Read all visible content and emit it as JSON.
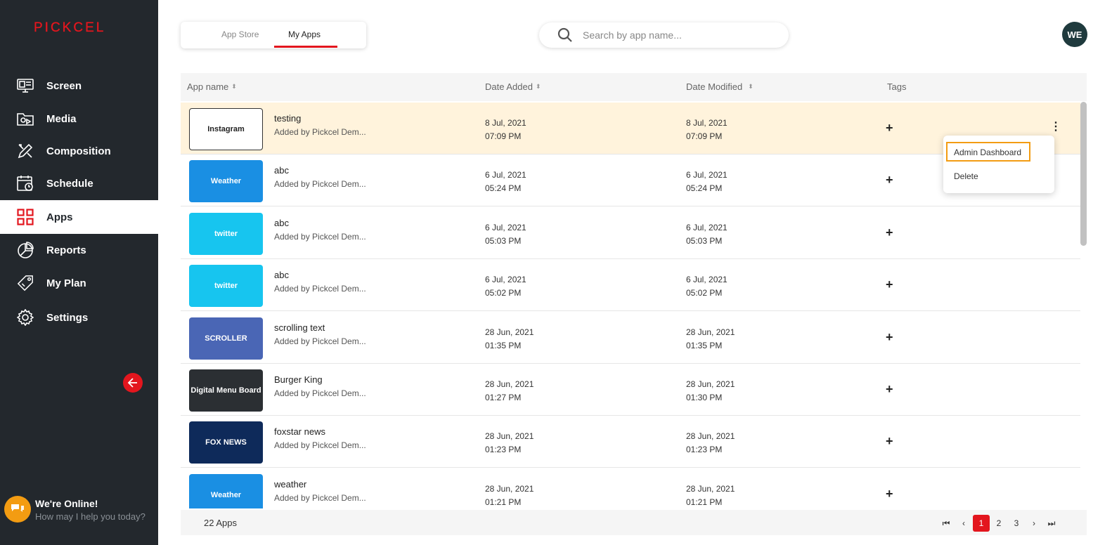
{
  "brand": {
    "logo_text": "PICKCEL",
    "accent": "#e3161e"
  },
  "sidebar": {
    "items": [
      {
        "label": "Screen",
        "icon": "screen-icon",
        "active": false
      },
      {
        "label": "Media",
        "icon": "media-folder-icon",
        "active": false
      },
      {
        "label": "Composition",
        "icon": "composition-icon",
        "active": false
      },
      {
        "label": "Schedule",
        "icon": "calendar-icon",
        "active": false
      },
      {
        "label": "Apps",
        "icon": "apps-grid-icon",
        "active": true
      },
      {
        "label": "Reports",
        "icon": "reports-pie-icon",
        "active": false
      },
      {
        "label": "My Plan",
        "icon": "plan-tag-icon",
        "active": false
      },
      {
        "label": "Settings",
        "icon": "gear-icon",
        "active": false
      }
    ]
  },
  "chat": {
    "title": "We're Online!",
    "subtitle": "How may I help you today?"
  },
  "tabs": {
    "app_store": "App Store",
    "my_apps": "My Apps"
  },
  "search": {
    "placeholder": "Search by app name..."
  },
  "user": {
    "initials": "WE"
  },
  "table": {
    "headers": {
      "app_name": "App name",
      "date_added": "Date Added",
      "date_modified": "Date Modified",
      "tags": "Tags"
    },
    "rows": [
      {
        "name": "testing",
        "added_by": "Added by Pickcel Dem...",
        "added_date": "8 Jul, 2021",
        "added_time": "07:09 PM",
        "mod_date": "8 Jul, 2021",
        "mod_time": "07:09 PM",
        "thumb": "Instagram",
        "thumb_color": "#ffffff",
        "highlighted": true
      },
      {
        "name": "abc",
        "added_by": "Added by Pickcel Dem...",
        "added_date": "6 Jul, 2021",
        "added_time": "05:24 PM",
        "mod_date": "6 Jul, 2021",
        "mod_time": "05:24 PM",
        "thumb": "Weather",
        "thumb_color": "#1a8fe3",
        "highlighted": false
      },
      {
        "name": "abc",
        "added_by": "Added by Pickcel Dem...",
        "added_date": "6 Jul, 2021",
        "added_time": "05:03 PM",
        "mod_date": "6 Jul, 2021",
        "mod_time": "05:03 PM",
        "thumb": "twitter",
        "thumb_color": "#17c5ef",
        "highlighted": false
      },
      {
        "name": "abc",
        "added_by": "Added by Pickcel Dem...",
        "added_date": "6 Jul, 2021",
        "added_time": "05:02 PM",
        "mod_date": "6 Jul, 2021",
        "mod_time": "05:02 PM",
        "thumb": "twitter",
        "thumb_color": "#17c5ef",
        "highlighted": false
      },
      {
        "name": "scrolling text",
        "added_by": "Added by Pickcel Dem...",
        "added_date": "28 Jun, 2021",
        "added_time": "01:35 PM",
        "mod_date": "28 Jun, 2021",
        "mod_time": "01:35 PM",
        "thumb": "SCROLLER",
        "thumb_color": "#4a66b5",
        "highlighted": false
      },
      {
        "name": "Burger King",
        "added_by": "Added by Pickcel Dem...",
        "added_date": "28 Jun, 2021",
        "added_time": "01:27 PM",
        "mod_date": "28 Jun, 2021",
        "mod_time": "01:30 PM",
        "thumb": "Digital Menu Board",
        "thumb_color": "#2b2f33",
        "highlighted": false
      },
      {
        "name": "foxstar news",
        "added_by": "Added by Pickcel Dem...",
        "added_date": "28 Jun, 2021",
        "added_time": "01:23 PM",
        "mod_date": "28 Jun, 2021",
        "mod_time": "01:23 PM",
        "thumb": "FOX NEWS",
        "thumb_color": "#0e2a5a",
        "highlighted": false
      },
      {
        "name": "weather",
        "added_by": "Added by Pickcel Dem...",
        "added_date": "28 Jun, 2021",
        "added_time": "01:21 PM",
        "mod_date": "28 Jun, 2021",
        "mod_time": "01:21 PM",
        "thumb": "Weather",
        "thumb_color": "#1a8fe3",
        "highlighted": false
      }
    ]
  },
  "context_menu": {
    "items": [
      "Admin Dashboard",
      "Delete"
    ]
  },
  "footer": {
    "count": "22 Apps",
    "pages": [
      "1",
      "2",
      "3"
    ],
    "current_page": "1"
  }
}
